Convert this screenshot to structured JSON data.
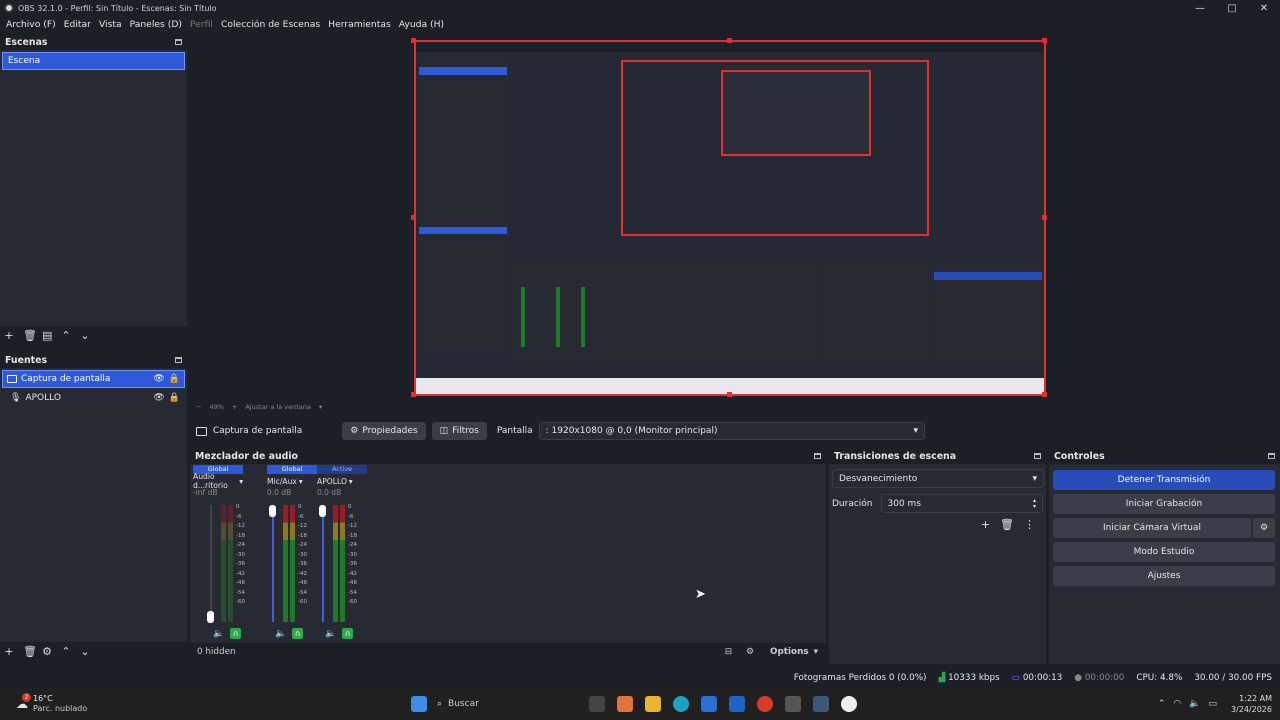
{
  "window": {
    "title": "OBS 32.1.0 - Perfil: Sin Título - Escenas: Sin Título",
    "min": "—",
    "max": "□",
    "close": "✕"
  },
  "menu": [
    {
      "label": "Archivo (F)",
      "enabled": true
    },
    {
      "label": "Editar",
      "enabled": true
    },
    {
      "label": "Vista",
      "enabled": true
    },
    {
      "label": "Paneles (D)",
      "enabled": true
    },
    {
      "label": "Perfil",
      "enabled": false
    },
    {
      "label": "Colección de Escenas",
      "enabled": true
    },
    {
      "label": "Herramientas",
      "enabled": true
    },
    {
      "label": "Ayuda (H)",
      "enabled": true
    }
  ],
  "scenes": {
    "title": "Escenas",
    "items": [
      "Escena"
    ]
  },
  "sources": {
    "title": "Fuentes",
    "items": [
      {
        "name": "Captura de pantalla",
        "selected": true
      },
      {
        "name": "APOLLO",
        "selected": false
      }
    ]
  },
  "preview": {
    "zoom": "49%",
    "fit_label": "Ajustar a la ventana"
  },
  "source_bar": {
    "source_name": "Captura de pantalla",
    "properties": "Propiedades",
    "filters": "Filtros",
    "display_label": "Pantalla",
    "display_value": ": 1920x1080 @ 0,0 (Monitor principal)"
  },
  "mixer": {
    "title": "Mezclador de audio",
    "channels": [
      {
        "head": "Global",
        "name": "Audio d...ritorio",
        "db": "-inf dB",
        "level": 0.0
      },
      {
        "head": "Global",
        "name": "Mic/Aux",
        "db": "0.0 dB",
        "level": 1.0
      },
      {
        "head": "Active",
        "name": "APOLLO",
        "db": "0.0 dB",
        "level": 1.0
      }
    ],
    "scale": [
      "0",
      "-6",
      "-12",
      "-18",
      "-24",
      "-30",
      "-36",
      "-42",
      "-48",
      "-54",
      "-60"
    ],
    "hidden": "0 hidden",
    "options": "Options"
  },
  "transitions": {
    "title": "Transiciones de escena",
    "type": "Desvanecimiento",
    "duration_label": "Duración",
    "duration_value": "300 ms"
  },
  "controls": {
    "title": "Controles",
    "stop_stream": "Detener Transmisión",
    "start_record": "Iniciar Grabación",
    "virtual_cam": "Iniciar Cámara Virtual",
    "studio_mode": "Modo Estudio",
    "settings": "Ajustes"
  },
  "status": {
    "dropped": "Fotogramas Perdidos 0 (0.0%)",
    "bitrate": "10333 kbps",
    "stream_time": "00:00:13",
    "rec_time": "00:00:00",
    "cpu": "CPU: 4.8%",
    "fps": "30.00 / 30.00 FPS"
  },
  "taskbar": {
    "weather_temp": "16°C",
    "weather_desc": "Parc. nublado",
    "notif_badge": "2",
    "search": "Buscar",
    "time": "1:22 AM",
    "date": "3/24/2026"
  },
  "colors": {
    "accent": "#2f59d9",
    "stream_button": "#284cb8",
    "selection_border": "#e03030",
    "meter_green": "#1f7a2a",
    "meter_yellow": "#8a7a22",
    "meter_red": "#9a1b25"
  }
}
